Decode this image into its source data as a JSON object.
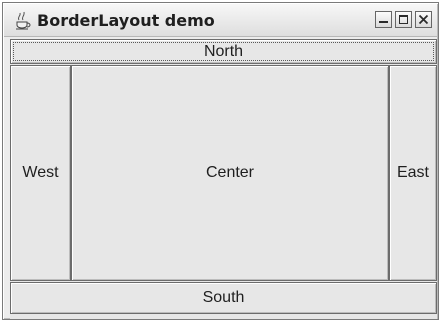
{
  "window": {
    "title": "BorderLayout demo",
    "icons": {
      "app": "java-app-icon",
      "minimize": "minimize-icon",
      "maximize": "maximize-icon",
      "close": "close-icon"
    }
  },
  "regions": {
    "north": "North",
    "west": "West",
    "center": "Center",
    "east": "East",
    "south": "South"
  }
}
